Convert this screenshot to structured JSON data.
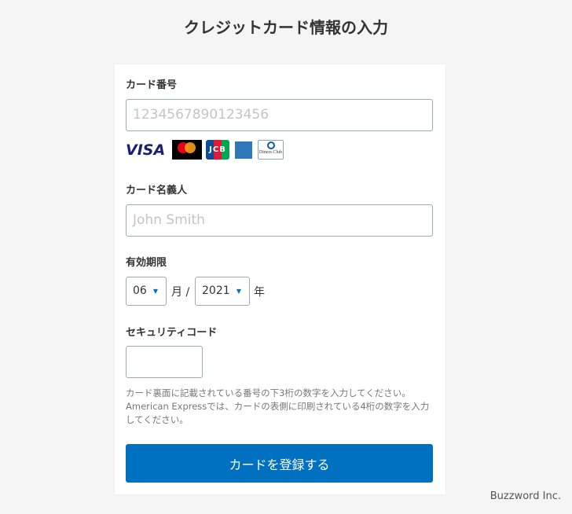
{
  "title": "クレジットカード情報の入力",
  "card_number": {
    "label": "カード番号",
    "placeholder": "1234567890123456"
  },
  "brands": [
    "VISA",
    "mastercard",
    "JCB",
    "AMERICAN EXPRESS",
    "Diners Club"
  ],
  "holder": {
    "label": "カード名義人",
    "placeholder": "John Smith"
  },
  "expiry": {
    "label": "有効期限",
    "month": "06",
    "month_unit": "月 /",
    "year": "2021",
    "year_unit": "年"
  },
  "security": {
    "label": "セキュリティコード",
    "help": "カード裏面に記載されている番号の下3桁の数字を入力してください。American Expressでは、カードの表側に印刷されている4桁の数字を入力してください。"
  },
  "submit_label": "カードを登録する",
  "footer": "Buzzword Inc.",
  "accent": "#0070c0"
}
